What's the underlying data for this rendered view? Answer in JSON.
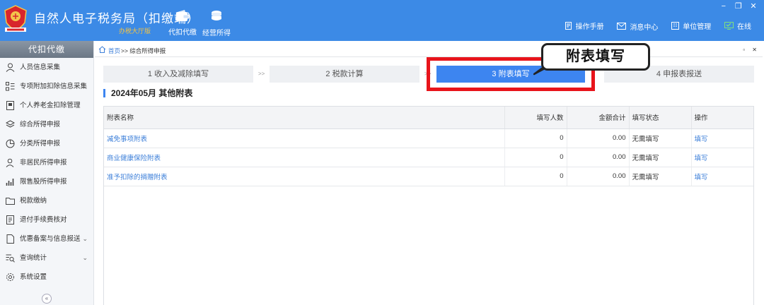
{
  "header": {
    "title": "自然人电子税务局（扣缴端）",
    "hall_label": "办税大厅版",
    "nav": [
      {
        "label": "代扣代缴",
        "icon": "wallet-icon"
      },
      {
        "label": "经营所得",
        "icon": "coins-icon"
      }
    ],
    "right_links": [
      {
        "label": "操作手册",
        "icon": "manual-icon"
      },
      {
        "label": "消息中心",
        "icon": "mail-icon"
      },
      {
        "label": "单位管理",
        "icon": "building-icon"
      },
      {
        "label": "在线",
        "icon": "online-icon"
      }
    ],
    "window_controls": [
      "−",
      "❐",
      "✕"
    ]
  },
  "sidebar": {
    "title": "代扣代缴",
    "items": [
      {
        "label": "人员信息采集",
        "icon": "person-icon",
        "expandable": false
      },
      {
        "label": "专项附加扣除信息采集",
        "icon": "grid-list-icon",
        "expandable": false
      },
      {
        "label": "个人养老金扣除管理",
        "icon": "document-icon",
        "expandable": false
      },
      {
        "label": "综合所得申报",
        "icon": "layers-icon",
        "expandable": false
      },
      {
        "label": "分类所得申报",
        "icon": "pie-chart-icon",
        "expandable": false
      },
      {
        "label": "非居民所得申报",
        "icon": "person-outline-icon",
        "expandable": false
      },
      {
        "label": "限售股所得申报",
        "icon": "bar-chart-icon",
        "expandable": false
      },
      {
        "label": "税款缴纳",
        "icon": "folder-icon",
        "expandable": false
      },
      {
        "label": "退付手续费核对",
        "icon": "receipt-icon",
        "expandable": false
      },
      {
        "label": "优惠备案与信息报送",
        "icon": "file-icon",
        "expandable": true
      },
      {
        "label": "查询统计",
        "icon": "search-list-icon",
        "expandable": true
      },
      {
        "label": "系统设置",
        "icon": "gear-icon",
        "expandable": false
      }
    ],
    "collapse_glyph": "«"
  },
  "breadcrumb": {
    "home": "首页",
    "rest": ">> 综合所得申报"
  },
  "steps": [
    {
      "label": "1 收入及减除填写",
      "active": false
    },
    {
      "label": "2 税款计算",
      "active": false
    },
    {
      "label": "3 附表填写",
      "active": true
    },
    {
      "label": "4 申报表报送",
      "active": false
    }
  ],
  "step_separator": ">>",
  "callout": "附表填写",
  "section_title": "2024年05月  其他附表",
  "table": {
    "headers": [
      "附表名称",
      "填写人数",
      "金额合计",
      "填写状态",
      "操作"
    ],
    "rows": [
      {
        "name": "减免事项附表",
        "count": "0",
        "amount": "0.00",
        "status": "无需填写",
        "action": "填写"
      },
      {
        "name": "商业健康保险附表",
        "count": "0",
        "amount": "0.00",
        "status": "无需填写",
        "action": "填写"
      },
      {
        "name": "准予扣除的捐赠附表",
        "count": "0",
        "amount": "0.00",
        "status": "无需填写",
        "action": "填写"
      }
    ]
  },
  "colors": {
    "header_bg": "#3c8ae6",
    "active_step": "#3d85f0",
    "highlight": "#e8141b",
    "link": "#3c7fd9"
  }
}
